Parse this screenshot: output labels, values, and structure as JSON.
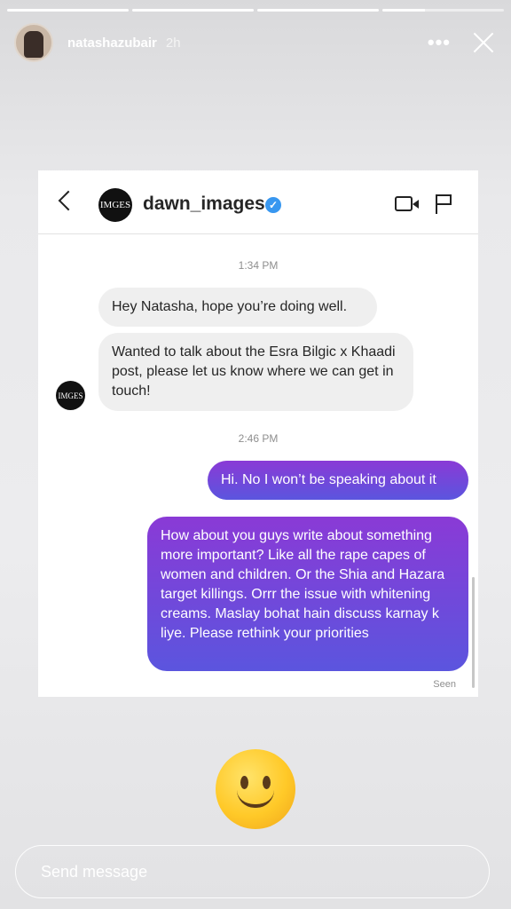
{
  "story": {
    "username": "natashazubair",
    "time_ago": "2h",
    "more_glyph": "•••",
    "send_placeholder": "Send message",
    "reaction_emoji": "slightly-smiling-face"
  },
  "dm": {
    "account": "dawn_images",
    "logo_text": "IMGES",
    "verified_glyph": "✓",
    "messages": [
      {
        "type": "timestamp",
        "text": "1:34 PM"
      },
      {
        "type": "received",
        "text": "Hey Natasha, hope you’re doing well."
      },
      {
        "type": "received",
        "text": "Wanted to talk about the Esra Bilgic x Khaadi post, please let us know where we can get in touch!"
      },
      {
        "type": "timestamp",
        "text": "2:46 PM"
      },
      {
        "type": "sent",
        "text": "Hi. No I won’t be speaking about it"
      },
      {
        "type": "sent",
        "text": "How about you guys write about something more important? Like all the rape capes of women and children. Or the Shia and Hazara target killings. Orrr the issue with whitening creams. Maslay bohat hain discuss karnay k liye. Please rethink your priorities"
      }
    ],
    "seen": "Seen"
  },
  "colors": {
    "sent_top": "#8a3ad6",
    "sent_bottom": "#5b55de",
    "verified": "#3897f0"
  }
}
